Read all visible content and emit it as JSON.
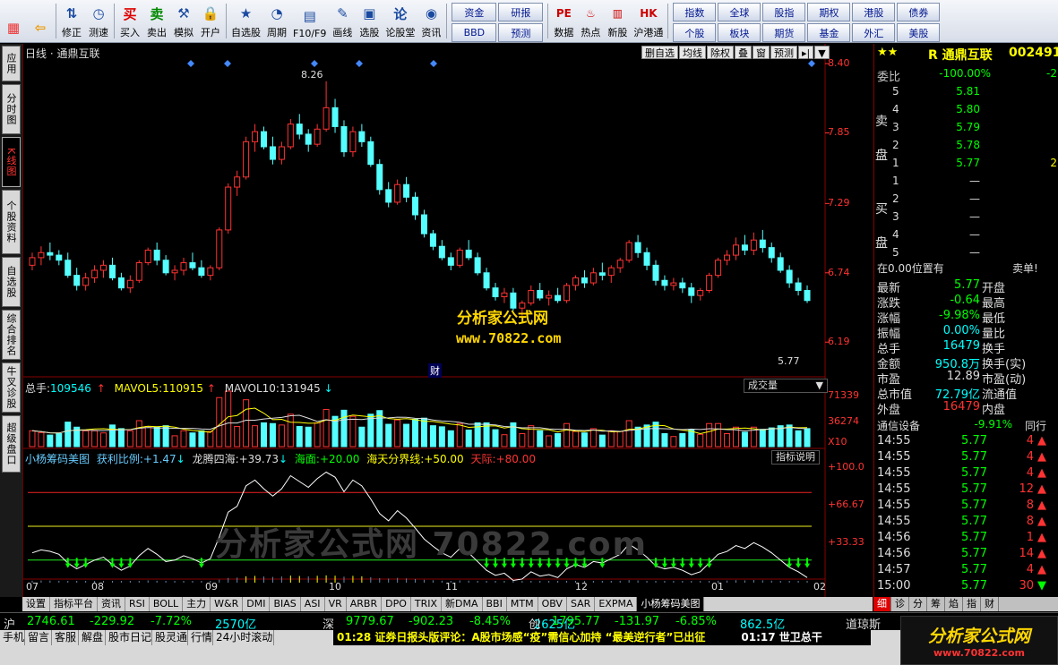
{
  "toolbar": {
    "left": [
      {
        "label": "",
        "icon": "windows-logo-icon"
      },
      {
        "label": "",
        "icon": "back-arrow-icon"
      },
      {
        "label": "修正",
        "icon": "fix-icon"
      },
      {
        "label": "测速",
        "icon": "clock-icon"
      },
      {
        "label": "买入",
        "icon": "buy-icon",
        "glyph": "买"
      },
      {
        "label": "卖出",
        "icon": "sell-icon",
        "glyph": "卖"
      },
      {
        "label": "模拟",
        "icon": "hammer-icon"
      },
      {
        "label": "开户",
        "icon": "lock-icon"
      },
      {
        "label": "自选股",
        "icon": "star-list-icon"
      },
      {
        "label": "周期",
        "icon": "clock-cycle-icon"
      },
      {
        "label": "F10/F9",
        "icon": "f10-icon"
      },
      {
        "label": "画线",
        "icon": "pen-icon"
      },
      {
        "label": "选股",
        "icon": "select-stock-icon"
      },
      {
        "label": "论股堂",
        "icon": "forum-icon"
      },
      {
        "label": "资讯",
        "icon": "info-icon"
      }
    ],
    "grid1": [
      "资金",
      "研报",
      "BBD",
      "预测"
    ],
    "mid": [
      {
        "label": "数据",
        "icon": "pe-icon"
      },
      {
        "label": "热点",
        "icon": "hot-icon"
      },
      {
        "label": "新股",
        "icon": "new-stock-icon"
      },
      {
        "label": "沪港通",
        "icon": "hk-icon"
      }
    ],
    "grid2": [
      "指数",
      "全球",
      "股指",
      "期权",
      "港股",
      "债券",
      "个股",
      "板块",
      "期货",
      "基金",
      "外汇",
      "美股"
    ]
  },
  "vtabs": [
    "应用",
    "分时图",
    "K线图",
    "个股资料",
    "自选股",
    "综合排名",
    "牛叉诊股",
    "超级盘口"
  ],
  "chart": {
    "title": "日线 · 通鼎互联",
    "buttons": [
      "删自选",
      "均线",
      "除权",
      "叠",
      "窗",
      "预测"
    ],
    "price_labels": [
      "8.40",
      "7.85",
      "7.29",
      "6.74",
      "6.19"
    ],
    "high_label": "8.26",
    "last_label": "5.77",
    "cai_label": "财",
    "watermark1": "分析家公式网",
    "watermark2": "www.70822.com",
    "watermark3": "分析家公式网 70822.com",
    "volume_header": {
      "total_label": "总手:",
      "total": "109546",
      "mavol5_label": "MAVOL5:",
      "mavol5": "110915",
      "mavol10_label": "MAVOL10:",
      "mavol10": "131945"
    },
    "volume_selector": "成交量",
    "volume_labels": [
      "71339",
      "36274",
      "X10"
    ],
    "indicator_header": {
      "name": "小杨筹码美图",
      "p1_label": "获利比例:",
      "p1": "+1.47",
      "p2_label": "龙腾四海:",
      "p2": "+39.73",
      "p3_label": "海面:",
      "p3": "+20.00",
      "p4_label": "海天分界线:",
      "p4": "+50.00",
      "p5_label": "天际:",
      "p5": "+80.00"
    },
    "indicator_button": "指标说明",
    "indicator_labels": [
      "+100.0",
      "+66.67",
      "+33.33"
    ],
    "date_labels": [
      "07",
      "08",
      "09",
      "10",
      "11",
      "12",
      "01",
      "02"
    ]
  },
  "chart_data": {
    "type": "candlestick",
    "series": [
      {
        "name": "K线",
        "ohlc": [
          [
            6.8,
            6.9,
            6.76,
            6.86
          ],
          [
            6.86,
            6.95,
            6.8,
            6.9
          ],
          [
            6.9,
            6.98,
            6.84,
            6.88
          ],
          [
            6.88,
            6.92,
            6.8,
            6.84
          ],
          [
            6.84,
            6.9,
            6.7,
            6.72
          ],
          [
            6.72,
            6.78,
            6.6,
            6.64
          ],
          [
            6.64,
            6.74,
            6.6,
            6.7
          ],
          [
            6.7,
            6.8,
            6.66,
            6.76
          ],
          [
            6.76,
            6.84,
            6.7,
            6.8
          ],
          [
            6.8,
            6.86,
            6.68,
            6.7
          ],
          [
            6.7,
            6.74,
            6.6,
            6.62
          ],
          [
            6.62,
            6.72,
            6.58,
            6.68
          ],
          [
            6.68,
            6.84,
            6.66,
            6.82
          ],
          [
            6.82,
            6.94,
            6.8,
            6.92
          ],
          [
            6.92,
            6.98,
            6.8,
            6.84
          ],
          [
            6.84,
            6.88,
            6.72,
            6.74
          ],
          [
            6.74,
            6.8,
            6.68,
            6.76
          ],
          [
            6.76,
            6.86,
            6.72,
            6.82
          ],
          [
            6.82,
            6.9,
            6.76,
            6.78
          ],
          [
            6.78,
            6.84,
            6.7,
            6.72
          ],
          [
            6.72,
            6.8,
            6.68,
            6.78
          ],
          [
            6.78,
            7.1,
            6.76,
            7.08
          ],
          [
            7.08,
            7.45,
            7.05,
            7.42
          ],
          [
            7.42,
            7.55,
            7.35,
            7.5
          ],
          [
            7.5,
            7.82,
            7.48,
            7.78
          ],
          [
            7.78,
            7.92,
            7.7,
            7.86
          ],
          [
            7.86,
            7.9,
            7.72,
            7.74
          ],
          [
            7.74,
            7.82,
            7.6,
            7.64
          ],
          [
            7.64,
            7.78,
            7.6,
            7.74
          ],
          [
            7.74,
            7.96,
            7.72,
            7.92
          ],
          [
            7.92,
            8.0,
            7.8,
            7.84
          ],
          [
            7.84,
            7.88,
            7.7,
            7.76
          ],
          [
            7.76,
            7.92,
            7.74,
            7.88
          ],
          [
            7.88,
            8.26,
            7.86,
            8.05
          ],
          [
            8.05,
            8.12,
            7.85,
            7.9
          ],
          [
            7.9,
            7.95,
            7.66,
            7.7
          ],
          [
            7.7,
            7.9,
            7.66,
            7.86
          ],
          [
            7.86,
            7.92,
            7.74,
            7.78
          ],
          [
            7.78,
            7.82,
            7.58,
            7.6
          ],
          [
            7.6,
            7.64,
            7.36,
            7.4
          ],
          [
            7.4,
            7.46,
            7.26,
            7.3
          ],
          [
            7.3,
            7.48,
            7.28,
            7.44
          ],
          [
            7.44,
            7.5,
            7.3,
            7.34
          ],
          [
            7.34,
            7.38,
            7.16,
            7.2
          ],
          [
            7.2,
            7.24,
            7.02,
            7.05
          ],
          [
            7.05,
            7.08,
            6.92,
            6.95
          ],
          [
            6.95,
            7.0,
            6.84,
            6.86
          ],
          [
            6.86,
            6.9,
            6.76,
            6.8
          ],
          [
            6.8,
            6.94,
            6.78,
            6.92
          ],
          [
            6.92,
            7.0,
            6.84,
            6.86
          ],
          [
            6.86,
            6.9,
            6.72,
            6.74
          ],
          [
            6.74,
            6.78,
            6.6,
            6.62
          ],
          [
            6.62,
            6.66,
            6.52,
            6.55
          ],
          [
            6.55,
            6.62,
            6.5,
            6.58
          ],
          [
            6.58,
            6.62,
            6.44,
            6.46
          ],
          [
            6.46,
            6.52,
            6.4,
            6.5
          ],
          [
            6.5,
            6.64,
            6.48,
            6.6
          ],
          [
            6.6,
            6.66,
            6.52,
            6.54
          ],
          [
            6.54,
            6.6,
            6.48,
            6.56
          ],
          [
            6.56,
            6.62,
            6.5,
            6.52
          ],
          [
            6.52,
            6.66,
            6.5,
            6.64
          ],
          [
            6.64,
            6.72,
            6.6,
            6.7
          ],
          [
            6.7,
            6.76,
            6.62,
            6.66
          ],
          [
            6.66,
            6.78,
            6.64,
            6.74
          ],
          [
            6.74,
            6.82,
            6.68,
            6.72
          ],
          [
            6.72,
            6.8,
            6.66,
            6.78
          ],
          [
            6.78,
            6.86,
            6.74,
            6.84
          ],
          [
            6.84,
            7.0,
            6.82,
            6.98
          ],
          [
            6.98,
            7.04,
            6.86,
            6.9
          ],
          [
            6.9,
            6.94,
            6.76,
            6.8
          ],
          [
            6.8,
            6.84,
            6.64,
            6.68
          ],
          [
            6.68,
            6.72,
            6.6,
            6.64
          ],
          [
            6.64,
            6.7,
            6.6,
            6.66
          ],
          [
            6.66,
            6.7,
            6.58,
            6.62
          ],
          [
            6.62,
            6.66,
            6.5,
            6.56
          ],
          [
            6.56,
            6.62,
            6.52,
            6.6
          ],
          [
            6.6,
            6.74,
            6.58,
            6.72
          ],
          [
            6.72,
            6.86,
            6.7,
            6.84
          ],
          [
            6.84,
            6.92,
            6.8,
            6.88
          ],
          [
            6.88,
            7.02,
            6.84,
            6.96
          ],
          [
            6.96,
            7.04,
            6.88,
            6.92
          ],
          [
            6.92,
            7.06,
            6.88,
            7.0
          ],
          [
            7.0,
            7.08,
            6.9,
            6.94
          ],
          [
            6.94,
            6.98,
            6.82,
            6.86
          ],
          [
            6.86,
            6.9,
            6.74,
            6.76
          ],
          [
            6.76,
            6.8,
            6.62,
            6.66
          ],
          [
            6.66,
            6.7,
            6.56,
            6.6
          ],
          [
            6.6,
            6.64,
            6.5,
            6.52
          ]
        ]
      }
    ],
    "ylim": [
      6.0,
      8.45
    ]
  },
  "quote": {
    "stars": "★★",
    "title": "R 通鼎互联",
    "code": "002491",
    "weibi_label": "委比",
    "weibi": "-100.00%",
    "weicha": "-2",
    "sell_label": "卖盘",
    "buy_label": "买盘",
    "sell": [
      {
        "n": "5",
        "p": "5.81",
        "v": ""
      },
      {
        "n": "4",
        "p": "5.80",
        "v": ""
      },
      {
        "n": "3",
        "p": "5.79",
        "v": ""
      },
      {
        "n": "2",
        "p": "5.78",
        "v": ""
      },
      {
        "n": "1",
        "p": "5.77",
        "v": "2"
      }
    ],
    "buy": [
      {
        "n": "1",
        "p": "—"
      },
      {
        "n": "2",
        "p": "—"
      },
      {
        "n": "3",
        "p": "—"
      },
      {
        "n": "4",
        "p": "—"
      },
      {
        "n": "5",
        "p": "—"
      }
    ],
    "pos_label": "在0.00位置有",
    "pos_right": "卖单!",
    "stats": [
      {
        "l": "最新",
        "v": "5.77",
        "c": "grn",
        "l2": "开盘"
      },
      {
        "l": "涨跌",
        "v": "-0.64",
        "c": "grn",
        "l2": "最高"
      },
      {
        "l": "涨幅",
        "v": "-9.98%",
        "c": "grn",
        "l2": "最低"
      },
      {
        "l": "振幅",
        "v": "0.00%",
        "c": "cyan",
        "l2": "量比"
      },
      {
        "l": "总手",
        "v": "16479",
        "c": "cyan",
        "l2": "换手"
      },
      {
        "l": "金额",
        "v": "950.8万",
        "c": "cyan",
        "l2": "换手(实)"
      },
      {
        "l": "市盈",
        "v": "12.89",
        "c": "wht",
        "l2": "市盈(动)"
      },
      {
        "l": "总市值",
        "v": "72.79亿",
        "c": "cyan",
        "l2": "流通值"
      },
      {
        "l": "外盘",
        "v": "16479",
        "c": "red",
        "l2": "内盘"
      }
    ],
    "industry": "通信设备",
    "industry_pct": "-9.91%",
    "industry_right": "同行",
    "ticks": [
      {
        "t": "14:55",
        "p": "5.77",
        "v": "4"
      },
      {
        "t": "14:55",
        "p": "5.77",
        "v": "4"
      },
      {
        "t": "14:55",
        "p": "5.77",
        "v": "4"
      },
      {
        "t": "14:55",
        "p": "5.77",
        "v": "12"
      },
      {
        "t": "14:55",
        "p": "5.77",
        "v": "8"
      },
      {
        "t": "14:55",
        "p": "5.77",
        "v": "8"
      },
      {
        "t": "14:56",
        "p": "5.77",
        "v": "1"
      },
      {
        "t": "14:56",
        "p": "5.77",
        "v": "14"
      },
      {
        "t": "14:57",
        "p": "5.77",
        "v": "4"
      },
      {
        "t": "15:00",
        "p": "5.77",
        "v": "30"
      }
    ],
    "tabs": [
      "细",
      "诊",
      "分",
      "筹",
      "焰",
      "指",
      "财"
    ]
  },
  "bottom_tabs": [
    "设置",
    "指标平台",
    "资讯",
    "RSI",
    "BOLL",
    "主力",
    "W&R",
    "DMI",
    "BIAS",
    "ASI",
    "VR",
    "ARBR",
    "DPO",
    "TRIX",
    "新DMA",
    "BBI",
    "MTM",
    "OBV",
    "SAR",
    "EXPMA",
    "小杨筹码美图"
  ],
  "ticker": [
    {
      "l": "沪",
      "v": "2746.61",
      "d": "-229.92",
      "p": "-7.72%",
      "a": "2570亿"
    },
    {
      "l": "深",
      "v": "9779.67",
      "d": "-902.23",
      "p": "-8.45%",
      "a": "2625亿"
    },
    {
      "l": "创",
      "v": "1795.77",
      "d": "-131.97",
      "p": "-6.85%",
      "a": "862.5亿"
    }
  ],
  "ticker_tail": "道琼斯",
  "statusbar": {
    "items": [
      "手机",
      "留言",
      "客服",
      "解盘",
      "股市日记",
      "股灵通",
      "行情",
      "24小时滚动"
    ],
    "news": "01:28 证券日报头版评论：A股市场感“疫”需信心加持 “最美逆行者”已出征",
    "time_news": "01:17 世卫总干"
  },
  "logo": {
    "line1": "分析家公式网",
    "line2": "www.70822.com"
  }
}
